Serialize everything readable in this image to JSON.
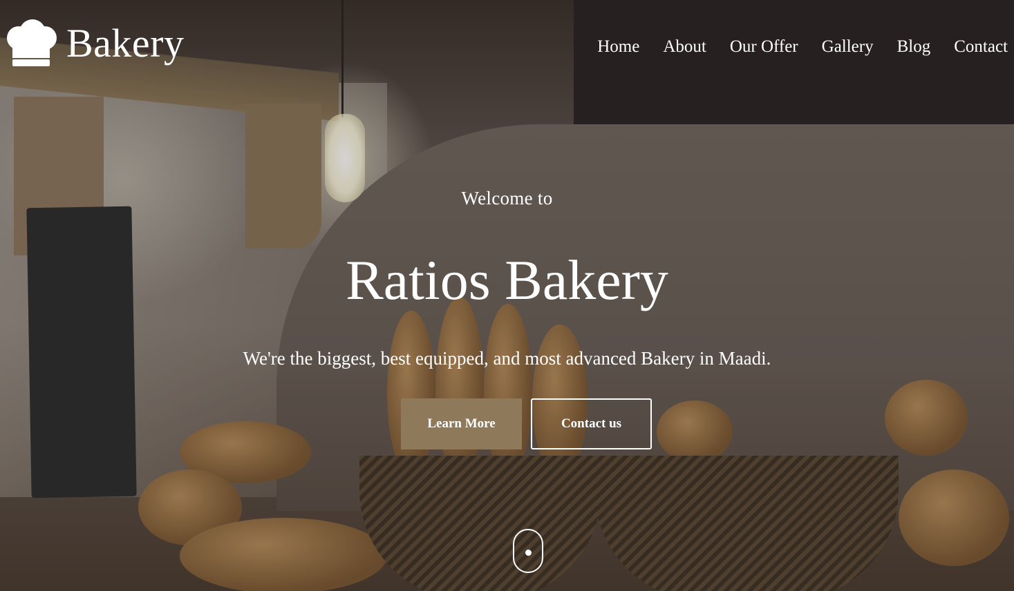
{
  "brand": {
    "name": "Bakery",
    "icon": "chef-hat-icon"
  },
  "nav": {
    "items": [
      {
        "label": "Home"
      },
      {
        "label": "About"
      },
      {
        "label": "Our Offer"
      },
      {
        "label": "Gallery"
      },
      {
        "label": "Blog"
      },
      {
        "label": "Contact"
      }
    ]
  },
  "hero": {
    "welcome": "Welcome to",
    "title": "Ratios Bakery",
    "subtitle": "We're the biggest, best equipped, and most advanced Bakery in Maadi.",
    "primary_button": "Learn More",
    "secondary_button": "Contact us",
    "scroll_icon": "mouse-scroll-icon"
  },
  "colors": {
    "accent": "#8e7a5b",
    "text": "#ffffff"
  }
}
